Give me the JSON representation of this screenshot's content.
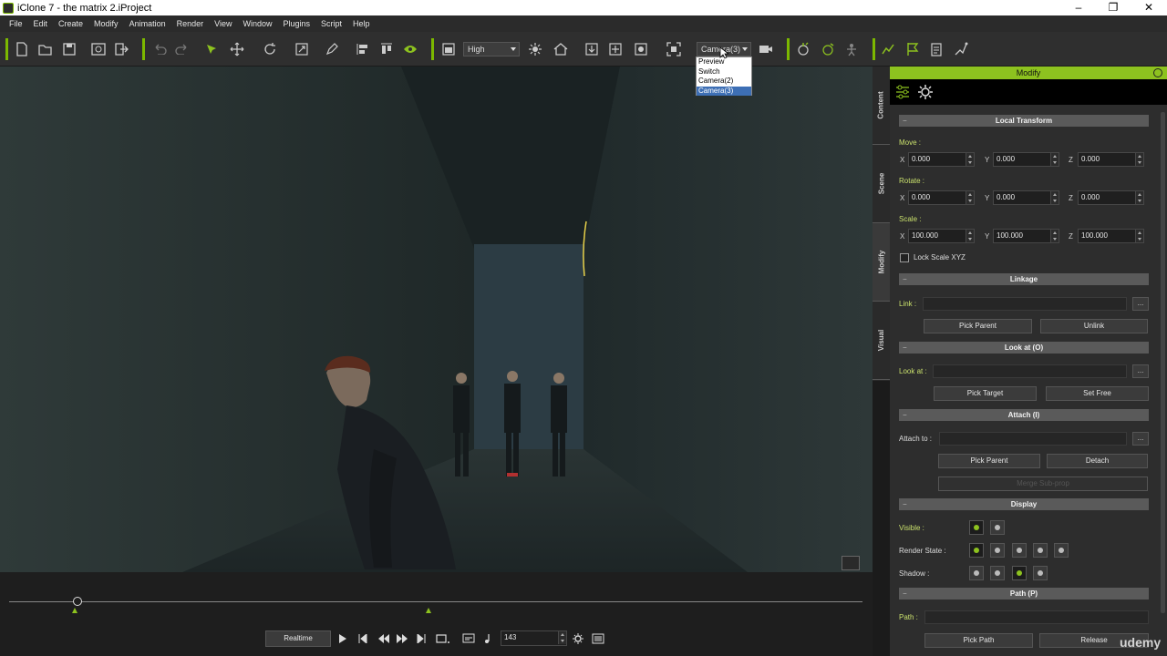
{
  "window": {
    "title": "iClone 7 - the matrix 2.iProject"
  },
  "menu": [
    "File",
    "Edit",
    "Create",
    "Modify",
    "Animation",
    "Render",
    "View",
    "Window",
    "Plugins",
    "Script",
    "Help"
  ],
  "toolbar": {
    "quality": "High",
    "camera": "Camera(3)",
    "camera_options": [
      "Preview",
      "Switch",
      "Camera(2)",
      "Camera(3)"
    ],
    "camera_selected": "Camera(3)"
  },
  "side_tabs": [
    "Content",
    "Scene",
    "Modify",
    "Visual"
  ],
  "panel": {
    "title": "Modify",
    "local_transform": {
      "title": "Local Transform",
      "move_label": "Move :",
      "rotate_label": "Rotate :",
      "scale_label": "Scale :",
      "move": {
        "x": "0.000",
        "y": "0.000",
        "z": "0.000"
      },
      "rotate": {
        "x": "0.000",
        "y": "0.000",
        "z": "0.000"
      },
      "scale": {
        "x": "100.000",
        "y": "100.000",
        "z": "100.000"
      },
      "axis_x": "X",
      "axis_y": "Y",
      "axis_z": "Z",
      "lock_scale": "Lock Scale XYZ"
    },
    "linkage": {
      "title": "Linkage",
      "link_label": "Link :",
      "pick_parent": "Pick Parent",
      "unlink": "Unlink"
    },
    "look_at": {
      "title": "Look at  (O)",
      "label": "Look at :",
      "pick_target": "Pick Target",
      "set_free": "Set Free"
    },
    "attach": {
      "title": "Attach  (I)",
      "label": "Attach to :",
      "pick_parent": "Pick Parent",
      "detach": "Detach",
      "merge": "Merge Sub-prop"
    },
    "display": {
      "title": "Display",
      "visible_label": "Visible :",
      "render_state_label": "Render State :",
      "shadow_label": "Shadow :"
    },
    "path": {
      "title": "Path  (P)",
      "label": "Path :",
      "pick_path": "Pick Path",
      "release": "Release"
    },
    "more_dots": "...",
    "collapse": "−"
  },
  "playback": {
    "mode": "Realtime",
    "frame": "143"
  },
  "watermark": "udemy",
  "colors": {
    "accent": "#8dc21f",
    "titlebar": "#ffffff",
    "panel": "#2d2d2d",
    "viewport": "#26302f"
  }
}
